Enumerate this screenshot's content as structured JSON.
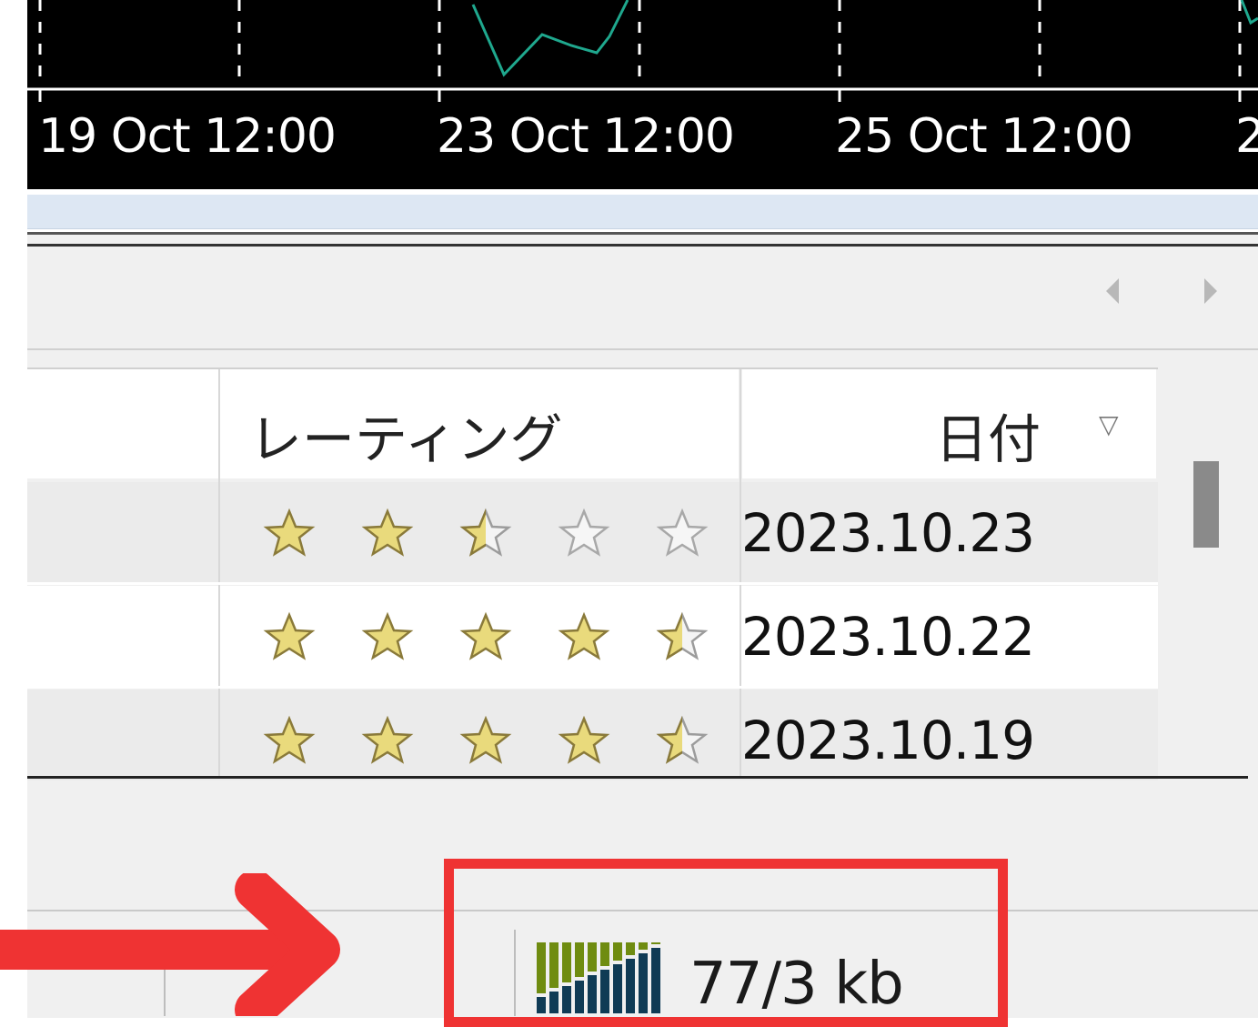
{
  "chart": {
    "time_labels": [
      "19 Oct 12:00",
      "23 Oct 12:00",
      "25 Oct 12:00",
      "2"
    ],
    "line_color": "#1fa88e",
    "grid_color": "#ffffff",
    "background": "#000000"
  },
  "navigation": {
    "left_arrow": "◀",
    "right_arrow": "▶"
  },
  "table": {
    "columns": {
      "rating": "レーティング",
      "date": "日付",
      "sort_indicator": "▽"
    },
    "rows": [
      {
        "stars": [
          1,
          1,
          0.5,
          0,
          0
        ],
        "date": "2023.10.23"
      },
      {
        "stars": [
          1,
          1,
          1,
          1,
          0.5
        ],
        "date": "2023.10.22"
      },
      {
        "stars": [
          1,
          1,
          1,
          1,
          0.5
        ],
        "date": "2023.10.19"
      }
    ]
  },
  "statusbar": {
    "traffic": "77/3 kb",
    "signal_icon": "connection-bars-icon"
  },
  "annotation": {
    "box_color": "#ef3333",
    "arrow_color": "#ef3333"
  }
}
